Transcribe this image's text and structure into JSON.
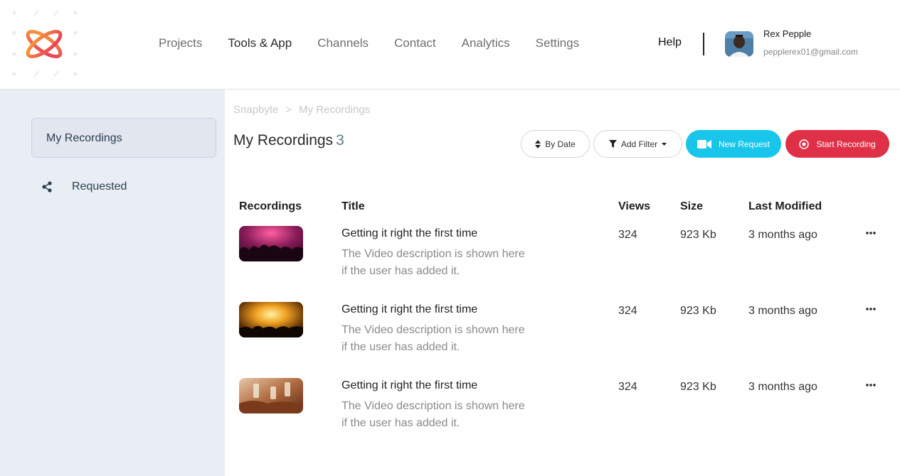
{
  "header": {
    "nav": [
      "Projects",
      "Tools & App",
      "Channels",
      "Contact",
      "Analytics",
      "Settings"
    ],
    "active_nav": "Tools & App",
    "help_label": "Help",
    "user": {
      "name": "Rex Pepple",
      "email": "pepplerex01@gmail.com"
    }
  },
  "sidebar": {
    "items": [
      {
        "label": "My Recordings",
        "icon": "none"
      },
      {
        "label": "Requested",
        "icon": "share-icon"
      }
    ]
  },
  "breadcrumb": {
    "root": "Snapbyte",
    "separator": ">",
    "current": "My Recordings"
  },
  "page": {
    "title": "My Recordings",
    "count": "3"
  },
  "toolbar": {
    "by_date": "By Date",
    "add_filter": "Add Filter",
    "new_request": "New Request",
    "start_recording": "Start Recording"
  },
  "table": {
    "headers": [
      "Recordings",
      "Title",
      "Views",
      "Size",
      "Last Modified"
    ],
    "rows": [
      {
        "title": "Getting it right the first time",
        "description": "The Video description is shown here if the user has added it.",
        "views": "324",
        "size": "923 Kb",
        "modified": "3 months ago"
      },
      {
        "title": "Getting it right the first time",
        "description": "The Video description is shown here if the user has added it.",
        "views": "324",
        "size": "923 Kb",
        "modified": "3 months ago"
      },
      {
        "title": "Getting it right the first time",
        "description": "The Video description is shown here if the user has added it.",
        "views": "324",
        "size": "923 Kb",
        "modified": "3 months ago"
      }
    ]
  },
  "colors": {
    "new_request": "#17c6ea",
    "start_recording": "#e03047",
    "sidebar_bg": "#e8eef3"
  }
}
